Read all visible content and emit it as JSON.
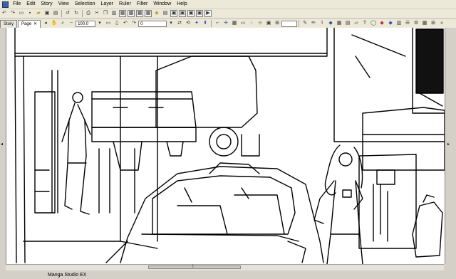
{
  "menu": [
    "File",
    "Edit",
    "Story",
    "View",
    "Selection",
    "Layer",
    "Ruler",
    "Filter",
    "Window",
    "Help"
  ],
  "tabs": [
    {
      "label": "Story",
      "active": false
    },
    {
      "label": "Page",
      "active": true,
      "close": "✕"
    }
  ],
  "zoom_value": "100.0",
  "rotation_value": "0",
  "status_text": "Manga Studio EX",
  "icons": [
    "new-icon",
    "open-icon",
    "save-icon",
    "print-icon",
    "undo-icon",
    "redo-icon",
    "zoom-icon",
    "rotate-icon",
    "ruler-icon",
    "pen-icon",
    "eraser-icon",
    "fill-icon"
  ]
}
